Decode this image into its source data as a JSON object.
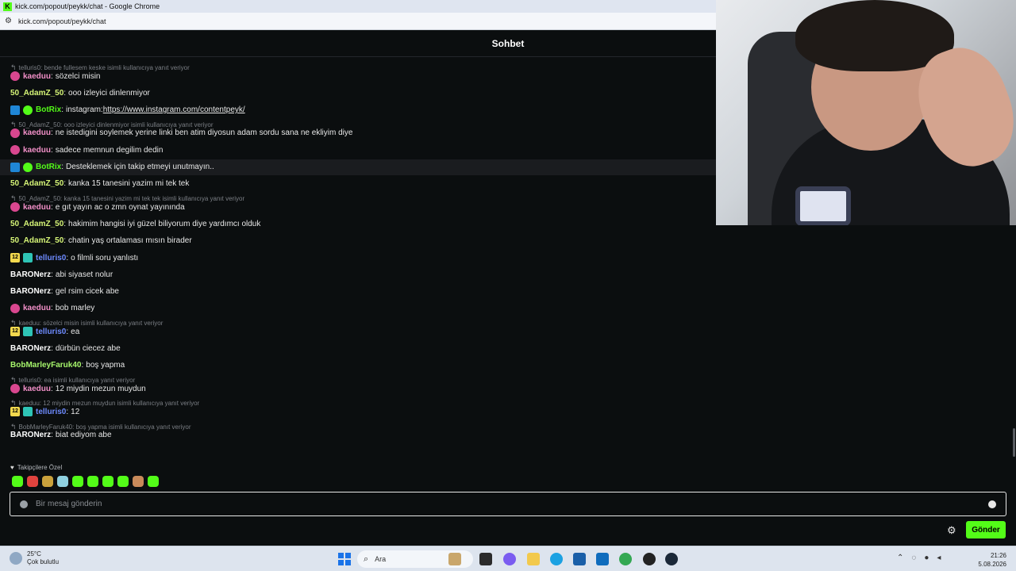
{
  "browser": {
    "window_title": "kick.com/popout/peykk/chat - Google Chrome",
    "url": "kick.com/popout/peykk/chat"
  },
  "chat": {
    "header": "Sohbet",
    "messages": [
      {
        "reply": "telluris0: bende fullesem keske isimli kullanıcıya yanıt veriyor",
        "badges": [
          "sub"
        ],
        "user": "kaeduu",
        "color": "#f290c8",
        "text": "sözelci misin"
      },
      {
        "user": "50_AdamZ_50",
        "color": "#d6f577",
        "text": "ooo izleyici dinlenmiyor"
      },
      {
        "badges": [
          "bot",
          "verified"
        ],
        "user": "BotRix",
        "color": "#53fc18",
        "text": "instagram: ",
        "link": "https://www.instagram.com/contentpeyk/"
      },
      {
        "reply": "50_AdamZ_50: ooo izleyici dinlenmiyor isimli kullanıcıya yanıt veriyor",
        "badges": [
          "sub"
        ],
        "user": "kaeduu",
        "color": "#f290c8",
        "text": "ne istedigini soylemek yerine linki ben atim diyosun adam sordu sana ne ekliyim diye"
      },
      {
        "badges": [
          "sub"
        ],
        "user": "kaeduu",
        "color": "#f290c8",
        "text": "sadece memnun degilim dedin"
      },
      {
        "badges": [
          "bot",
          "verified"
        ],
        "user": "BotRix",
        "color": "#53fc18",
        "text": "Desteklemek için takip etmeyi unutmayın..",
        "highlight": true
      },
      {
        "user": "50_AdamZ_50",
        "color": "#d6f577",
        "text": "kanka 15 tanesini yazim mi tek tek"
      },
      {
        "reply": "50_AdamZ_50: kanka 15 tanesini yazim mi tek tek isimli kullanıcıya yanıt veriyor",
        "badges": [
          "sub"
        ],
        "user": "kaeduu",
        "color": "#f290c8",
        "text": "e gıt yayın ac o zmn oynat yayınında"
      },
      {
        "user": "50_AdamZ_50",
        "color": "#d6f577",
        "text": "hakimim hangisi iyi güzel biliyorum diye yardımcı olduk"
      },
      {
        "user": "50_AdamZ_50",
        "color": "#d6f577",
        "text": "chatin yaş ortalaması mısın birader"
      },
      {
        "badges": [
          "yellow",
          "teal"
        ],
        "badge_text": "12",
        "user": "telluris0",
        "color": "#6e8bff",
        "text": "o filmli soru yanlıstı"
      },
      {
        "user": "BARONerz",
        "color": "#ffffff",
        "text": "abi siyaset nolur"
      },
      {
        "user": "BARONerz",
        "color": "#ffffff",
        "text": "gel rsim cicek abe"
      },
      {
        "badges": [
          "sub"
        ],
        "user": "kaeduu",
        "color": "#f290c8",
        "text": "bob marley"
      },
      {
        "reply": "kaeduu: sözelci misin isimli kullanıcıya yanıt veriyor",
        "badges": [
          "yellow",
          "teal"
        ],
        "badge_text": "12",
        "user": "telluris0",
        "color": "#6e8bff",
        "text": "ea"
      },
      {
        "user": "BARONerz",
        "color": "#ffffff",
        "text": "dürbün ciecez abe"
      },
      {
        "user": "BobMarleyFaruk40",
        "color": "#a6f56b",
        "text": "boş yapma"
      },
      {
        "reply": "telluris0: ea isimli kullanıcıya yanıt veriyor",
        "badges": [
          "sub"
        ],
        "user": "kaeduu",
        "color": "#f290c8",
        "text": "12 miydin mezun muydun"
      },
      {
        "reply": "kaeduu: 12 miydin mezun muydun isimli kullanıcıya yanıt veriyor",
        "badges": [
          "yellow",
          "teal"
        ],
        "badge_text": "12",
        "user": "telluris0",
        "color": "#6e8bff",
        "text": "12"
      },
      {
        "reply": "BobMarleyFaruk40: boş yapma isimli kullanıcıya yanıt veriyor",
        "user": "BARONerz",
        "color": "#ffffff",
        "text": "biat ediyom abe"
      }
    ],
    "followers_label": "Takipçilere Özel",
    "emote_count": 10,
    "input_placeholder": "Bir mesaj gönderin",
    "send_label": "Gönder"
  },
  "taskbar": {
    "weather_temp": "25°C",
    "weather_desc": "Çok bulutlu",
    "search_label": "Ara",
    "time": "21:26",
    "date": "5.08.2026"
  }
}
